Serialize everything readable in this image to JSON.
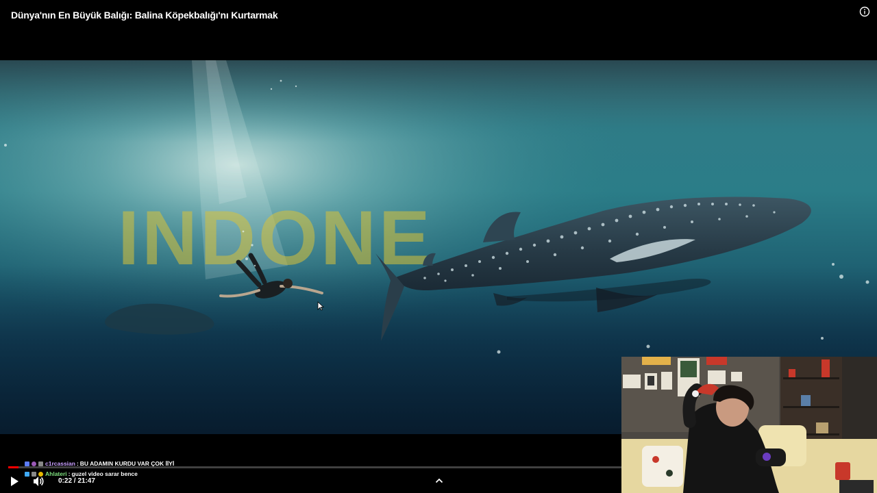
{
  "video": {
    "title": "Dünya'nın En Büyük Balığı: Balina Köpekbalığı'nı Kurtarmak",
    "overlay_text": "INDONE",
    "current_time": "0:22",
    "duration": "21:47",
    "time_display": "0:22 / 21:47",
    "progress_fraction": 0.0168
  },
  "chat": {
    "messages": [
      {
        "user": "c1rcassian",
        "separator": " : ",
        "text": "BU ADAMIN KURDU VAR ÇOK İİYİ"
      },
      {
        "user": "Ahlateri",
        "separator": " : ",
        "text": "guzel video sarar bence"
      }
    ]
  },
  "colors": {
    "progress": "#ff0000",
    "background": "#000000",
    "overlay_text": "#d8c23a",
    "user1": "#c9a0ff",
    "user2": "#7ee07e"
  },
  "icons": {
    "info": "info-icon",
    "play": "play-icon",
    "volume": "volume-icon",
    "expand": "chevron-up-icon"
  }
}
